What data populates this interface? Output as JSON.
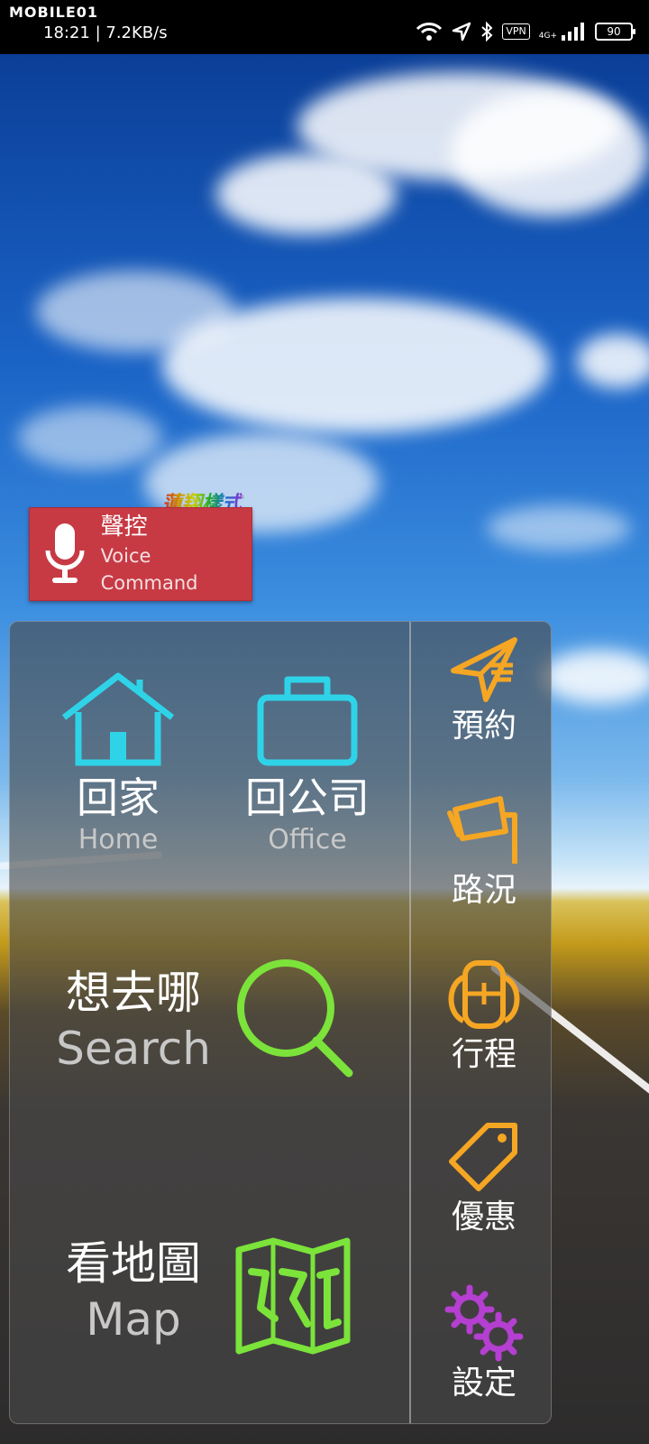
{
  "status_bar": {
    "brand": "MOBILE01",
    "time_speed": "18:21 | 7.2KB/s",
    "network": "4G+",
    "vpn": "VPN",
    "battery": "90"
  },
  "voice": {
    "brand_tag": "蓮翔樣式",
    "title_zh": "聲控",
    "title_en": "Voice Command"
  },
  "tiles": {
    "home": {
      "zh": "回家",
      "en": "Home",
      "icon": "house-icon"
    },
    "office": {
      "zh": "回公司",
      "en": "Office",
      "icon": "briefcase-icon"
    },
    "search": {
      "zh": "想去哪",
      "en": "Search",
      "icon": "magnifier-icon"
    },
    "map": {
      "zh": "看地圖",
      "en": "Map",
      "icon": "folded-map-icon"
    }
  },
  "sidebar": {
    "items": [
      {
        "label": "預約",
        "icon": "paper-plane-icon"
      },
      {
        "label": "路況",
        "icon": "traffic-camera-icon"
      },
      {
        "label": "行程",
        "icon": "backpack-icon"
      },
      {
        "label": "優惠",
        "icon": "price-tag-icon"
      },
      {
        "label": "設定",
        "icon": "gears-icon"
      }
    ]
  },
  "colors": {
    "cyan": "#2fd3e8",
    "green": "#7be33a",
    "orange": "#f5a623",
    "purple": "#b43fd0",
    "voice_red": "#c73a44"
  }
}
